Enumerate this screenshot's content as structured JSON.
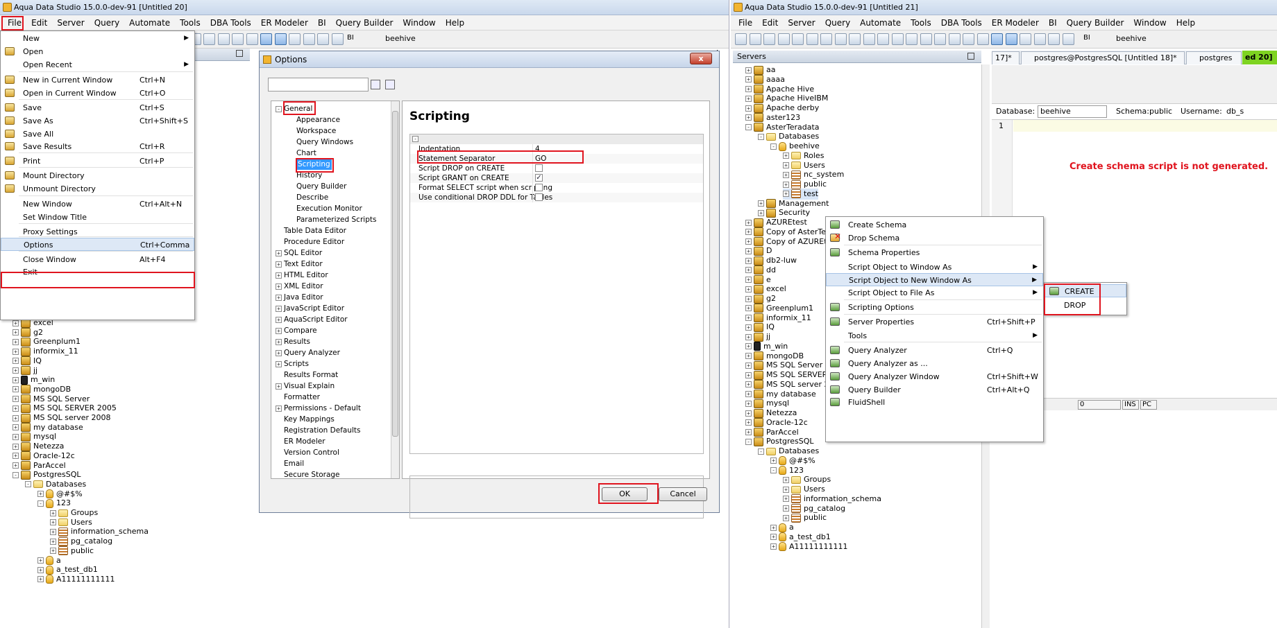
{
  "colors": {
    "highlight_box": "#e0141e",
    "note": "#e0141e",
    "selection": "#3399ff"
  },
  "win1": {
    "title": "Aqua Data Studio 15.0.0-dev-91 [Untitled 20]",
    "menubar": [
      "File",
      "Edit",
      "Server",
      "Query",
      "Automate",
      "Tools",
      "DBA Tools",
      "ER Modeler",
      "BI",
      "Query Builder",
      "Window",
      "Help"
    ],
    "toolbar_db": "beehive",
    "toolbar_bi": "BI",
    "file_menu": [
      {
        "label": "New",
        "shortcut": "",
        "submenu": true,
        "icon": ""
      },
      {
        "label": "Open",
        "shortcut": "",
        "submenu": false,
        "icon": "folder-open-icon"
      },
      {
        "label": "Open Recent",
        "shortcut": "",
        "submenu": true,
        "icon": ""
      },
      {
        "label": "New in Current Window",
        "shortcut": "Ctrl+N",
        "submenu": false,
        "icon": "new-document-icon"
      },
      {
        "label": "Open in Current Window",
        "shortcut": "Ctrl+O",
        "submenu": false,
        "icon": "folder-open-icon"
      },
      {
        "label": "Save",
        "shortcut": "Ctrl+S",
        "submenu": false,
        "icon": "save-icon"
      },
      {
        "label": "Save As",
        "shortcut": "Ctrl+Shift+S",
        "submenu": false,
        "icon": "save-as-icon"
      },
      {
        "label": "Save All",
        "shortcut": "",
        "submenu": false,
        "icon": "save-all-icon"
      },
      {
        "label": "Save Results",
        "shortcut": "Ctrl+R",
        "submenu": false,
        "icon": "save-results-icon"
      },
      {
        "label": "Print",
        "shortcut": "Ctrl+P",
        "submenu": false,
        "icon": "print-icon"
      },
      {
        "label": "Mount Directory",
        "shortcut": "",
        "submenu": false,
        "icon": "mount-icon"
      },
      {
        "label": "Unmount Directory",
        "shortcut": "",
        "submenu": false,
        "icon": "unmount-icon"
      },
      {
        "label": "New Window",
        "shortcut": "Ctrl+Alt+N",
        "submenu": false,
        "icon": ""
      },
      {
        "label": "Set Window Title",
        "shortcut": "",
        "submenu": false,
        "icon": ""
      },
      {
        "label": "Proxy Settings",
        "shortcut": "",
        "submenu": false,
        "icon": ""
      },
      {
        "label": "Options",
        "shortcut": "Ctrl+Comma",
        "submenu": false,
        "icon": ""
      },
      {
        "label": "Close Window",
        "shortcut": "Alt+F4",
        "submenu": false,
        "icon": ""
      },
      {
        "label": "Exit",
        "shortcut": "",
        "submenu": false,
        "icon": ""
      }
    ],
    "tree_bottom": [
      {
        "label": "excel",
        "indent": 0,
        "icon": "srv",
        "pm": "+"
      },
      {
        "label": "g2",
        "indent": 0,
        "icon": "srv",
        "pm": "+"
      },
      {
        "label": "Greenplum1",
        "indent": 0,
        "icon": "srv",
        "pm": "+"
      },
      {
        "label": "informix_11",
        "indent": 0,
        "icon": "srv",
        "pm": "+"
      },
      {
        "label": "IQ",
        "indent": 0,
        "icon": "srv",
        "pm": "+"
      },
      {
        "label": "jj",
        "indent": 0,
        "icon": "srv",
        "pm": "+"
      },
      {
        "label": "m_win",
        "indent": 0,
        "icon": "bin",
        "pm": "+"
      },
      {
        "label": "mongoDB",
        "indent": 0,
        "icon": "srv",
        "pm": "+"
      },
      {
        "label": "MS SQL Server",
        "indent": 0,
        "icon": "srv",
        "pm": "+"
      },
      {
        "label": "MS SQL SERVER 2005",
        "indent": 0,
        "icon": "srv",
        "pm": "+"
      },
      {
        "label": "MS SQL server 2008",
        "indent": 0,
        "icon": "srv",
        "pm": "+"
      },
      {
        "label": "my database",
        "indent": 0,
        "icon": "srv",
        "pm": "+"
      },
      {
        "label": "mysql",
        "indent": 0,
        "icon": "srv",
        "pm": "+"
      },
      {
        "label": "Netezza",
        "indent": 0,
        "icon": "srv",
        "pm": "+"
      },
      {
        "label": "Oracle-12c",
        "indent": 0,
        "icon": "srv",
        "pm": "+"
      },
      {
        "label": "ParAccel",
        "indent": 0,
        "icon": "srv",
        "pm": "+"
      },
      {
        "label": "PostgresSQL",
        "indent": 0,
        "icon": "srv",
        "pm": "-"
      },
      {
        "label": "Databases",
        "indent": 1,
        "icon": "fold",
        "pm": "-"
      },
      {
        "label": "@#$%",
        "indent": 2,
        "icon": "db",
        "pm": "+"
      },
      {
        "label": "123",
        "indent": 2,
        "icon": "db",
        "pm": "-"
      },
      {
        "label": "Groups",
        "indent": 3,
        "icon": "fold",
        "pm": "+"
      },
      {
        "label": "Users",
        "indent": 3,
        "icon": "fold",
        "pm": "+"
      },
      {
        "label": "information_schema",
        "indent": 3,
        "icon": "sch",
        "pm": "+"
      },
      {
        "label": "pg_catalog",
        "indent": 3,
        "icon": "sch",
        "pm": "+"
      },
      {
        "label": "public",
        "indent": 3,
        "icon": "sch",
        "pm": "+"
      },
      {
        "label": "a",
        "indent": 2,
        "icon": "db",
        "pm": "+"
      },
      {
        "label": "a_test_db1",
        "indent": 2,
        "icon": "db",
        "pm": "+"
      },
      {
        "label": "A11111111111",
        "indent": 2,
        "icon": "db",
        "pm": "+"
      }
    ],
    "tab_fragment": "d",
    "options_dialog": {
      "title": "Options",
      "close": "x",
      "section_title": "Scripting",
      "nav": [
        {
          "label": "General",
          "indent": 0,
          "pm": "-"
        },
        {
          "label": "Appearance",
          "indent": 1,
          "pm": ""
        },
        {
          "label": "Workspace",
          "indent": 1,
          "pm": ""
        },
        {
          "label": "Query Windows",
          "indent": 1,
          "pm": ""
        },
        {
          "label": "Chart",
          "indent": 1,
          "pm": ""
        },
        {
          "label": "Scripting",
          "indent": 1,
          "pm": ""
        },
        {
          "label": "History",
          "indent": 1,
          "pm": ""
        },
        {
          "label": "Query Builder",
          "indent": 1,
          "pm": ""
        },
        {
          "label": "Describe",
          "indent": 1,
          "pm": ""
        },
        {
          "label": "Execution Monitor",
          "indent": 1,
          "pm": ""
        },
        {
          "label": "Parameterized Scripts",
          "indent": 1,
          "pm": ""
        },
        {
          "label": "Table Data Editor",
          "indent": 0,
          "pm": ""
        },
        {
          "label": "Procedure Editor",
          "indent": 0,
          "pm": ""
        },
        {
          "label": "SQL Editor",
          "indent": 0,
          "pm": "+"
        },
        {
          "label": "Text Editor",
          "indent": 0,
          "pm": "+"
        },
        {
          "label": "HTML Editor",
          "indent": 0,
          "pm": "+"
        },
        {
          "label": "XML Editor",
          "indent": 0,
          "pm": "+"
        },
        {
          "label": "Java Editor",
          "indent": 0,
          "pm": "+"
        },
        {
          "label": "JavaScript Editor",
          "indent": 0,
          "pm": "+"
        },
        {
          "label": "AquaScript Editor",
          "indent": 0,
          "pm": "+"
        },
        {
          "label": "Compare",
          "indent": 0,
          "pm": "+"
        },
        {
          "label": "Results",
          "indent": 0,
          "pm": "+"
        },
        {
          "label": "Query Analyzer",
          "indent": 0,
          "pm": "+"
        },
        {
          "label": "Scripts",
          "indent": 0,
          "pm": "+"
        },
        {
          "label": "Results Format",
          "indent": 0,
          "pm": ""
        },
        {
          "label": "Visual Explain",
          "indent": 0,
          "pm": "+"
        },
        {
          "label": "Formatter",
          "indent": 0,
          "pm": ""
        },
        {
          "label": "Permissions - Default",
          "indent": 0,
          "pm": "+"
        },
        {
          "label": "Key Mappings",
          "indent": 0,
          "pm": ""
        },
        {
          "label": "Registration Defaults",
          "indent": 0,
          "pm": ""
        },
        {
          "label": "ER Modeler",
          "indent": 0,
          "pm": ""
        },
        {
          "label": "Version Control",
          "indent": 0,
          "pm": ""
        },
        {
          "label": "Email",
          "indent": 0,
          "pm": ""
        },
        {
          "label": "Secure Storage",
          "indent": 0,
          "pm": ""
        }
      ],
      "props": [
        {
          "label": "Indentation",
          "value": "4",
          "checkbox": false,
          "checked": false
        },
        {
          "label": "Statement Separator",
          "value": "GO",
          "checkbox": false,
          "checked": false
        },
        {
          "label": "Script DROP on CREATE",
          "value": "",
          "checkbox": true,
          "checked": false
        },
        {
          "label": "Script GRANT on CREATE",
          "value": "",
          "checkbox": true,
          "checked": true
        },
        {
          "label": "Format SELECT script when scripting",
          "value": "",
          "checkbox": true,
          "checked": false
        },
        {
          "label": "Use conditional DROP DDL for Tables",
          "value": "",
          "checkbox": true,
          "checked": false
        }
      ],
      "ok": "OK",
      "cancel": "Cancel"
    }
  },
  "win2": {
    "title": "Aqua Data Studio 15.0.0-dev-91 [Untitled 21]",
    "menubar": [
      "File",
      "Edit",
      "Server",
      "Query",
      "Automate",
      "Tools",
      "DBA Tools",
      "ER Modeler",
      "BI",
      "Query Builder",
      "Window",
      "Help"
    ],
    "toolbar_db": "beehive",
    "toolbar_bi": "BI",
    "servers_title": "Servers",
    "tree": [
      {
        "label": "aa",
        "indent": 0,
        "icon": "srv",
        "pm": "+"
      },
      {
        "label": "aaaa",
        "indent": 0,
        "icon": "srv",
        "pm": "+"
      },
      {
        "label": "Apache Hive",
        "indent": 0,
        "icon": "srv",
        "pm": "+"
      },
      {
        "label": "Apache HiveIBM",
        "indent": 0,
        "icon": "srv",
        "pm": "+"
      },
      {
        "label": "Apache derby",
        "indent": 0,
        "icon": "srv",
        "pm": "+"
      },
      {
        "label": "aster123",
        "indent": 0,
        "icon": "srv",
        "pm": "+"
      },
      {
        "label": "AsterTeradata",
        "indent": 0,
        "icon": "srv",
        "pm": "-"
      },
      {
        "label": "Databases",
        "indent": 1,
        "icon": "fold",
        "pm": "-"
      },
      {
        "label": "beehive",
        "indent": 2,
        "icon": "db",
        "pm": "-"
      },
      {
        "label": "Roles",
        "indent": 3,
        "icon": "fold",
        "pm": "+"
      },
      {
        "label": "Users",
        "indent": 3,
        "icon": "fold",
        "pm": "+"
      },
      {
        "label": "nc_system",
        "indent": 3,
        "icon": "sch",
        "pm": "+"
      },
      {
        "label": "public",
        "indent": 3,
        "icon": "sch",
        "pm": "+"
      },
      {
        "label": "test",
        "indent": 3,
        "icon": "sch",
        "pm": "+"
      },
      {
        "label": "Management",
        "indent": 1,
        "icon": "srv",
        "pm": "+"
      },
      {
        "label": "Security",
        "indent": 1,
        "icon": "srv",
        "pm": "+"
      },
      {
        "label": "AZUREtest",
        "indent": 0,
        "icon": "srv",
        "pm": "+"
      },
      {
        "label": "Copy of AsterTeradata",
        "indent": 0,
        "icon": "srv",
        "pm": "+"
      },
      {
        "label": "Copy of AZUREtest",
        "indent": 0,
        "icon": "srv",
        "pm": "+"
      },
      {
        "label": "D",
        "indent": 0,
        "icon": "srv",
        "pm": "+"
      },
      {
        "label": "db2-luw",
        "indent": 0,
        "icon": "srv",
        "pm": "+"
      },
      {
        "label": "dd",
        "indent": 0,
        "icon": "srv",
        "pm": "+"
      },
      {
        "label": "e",
        "indent": 0,
        "icon": "srv",
        "pm": "+"
      },
      {
        "label": "excel",
        "indent": 0,
        "icon": "srv",
        "pm": "+"
      },
      {
        "label": "g2",
        "indent": 0,
        "icon": "srv",
        "pm": "+"
      },
      {
        "label": "Greenplum1",
        "indent": 0,
        "icon": "srv",
        "pm": "+"
      },
      {
        "label": "informix_11",
        "indent": 0,
        "icon": "srv",
        "pm": "+"
      },
      {
        "label": "IQ",
        "indent": 0,
        "icon": "srv",
        "pm": "+"
      },
      {
        "label": "jj",
        "indent": 0,
        "icon": "srv",
        "pm": "+"
      },
      {
        "label": "m_win",
        "indent": 0,
        "icon": "bin",
        "pm": "+"
      },
      {
        "label": "mongoDB",
        "indent": 0,
        "icon": "srv",
        "pm": "+"
      },
      {
        "label": "MS SQL Server",
        "indent": 0,
        "icon": "srv",
        "pm": "+"
      },
      {
        "label": "MS SQL SERVER 2005",
        "indent": 0,
        "icon": "srv",
        "pm": "+"
      },
      {
        "label": "MS SQL server 2008",
        "indent": 0,
        "icon": "srv",
        "pm": "+"
      },
      {
        "label": "my database",
        "indent": 0,
        "icon": "srv",
        "pm": "+"
      },
      {
        "label": "mysql",
        "indent": 0,
        "icon": "srv",
        "pm": "+"
      },
      {
        "label": "Netezza",
        "indent": 0,
        "icon": "srv",
        "pm": "+"
      },
      {
        "label": "Oracle-12c",
        "indent": 0,
        "icon": "srv",
        "pm": "+"
      },
      {
        "label": "ParAccel",
        "indent": 0,
        "icon": "srv",
        "pm": "+"
      },
      {
        "label": "PostgresSQL",
        "indent": 0,
        "icon": "srv",
        "pm": "-"
      },
      {
        "label": "Databases",
        "indent": 1,
        "icon": "fold",
        "pm": "-"
      },
      {
        "label": "@#$%",
        "indent": 2,
        "icon": "db",
        "pm": "+"
      },
      {
        "label": "123",
        "indent": 2,
        "icon": "db",
        "pm": "-"
      },
      {
        "label": "Groups",
        "indent": 3,
        "icon": "fold",
        "pm": "+"
      },
      {
        "label": "Users",
        "indent": 3,
        "icon": "fold",
        "pm": "+"
      },
      {
        "label": "information_schema",
        "indent": 3,
        "icon": "sch",
        "pm": "+"
      },
      {
        "label": "pg_catalog",
        "indent": 3,
        "icon": "sch",
        "pm": "+"
      },
      {
        "label": "public",
        "indent": 3,
        "icon": "sch",
        "pm": "+"
      },
      {
        "label": "a",
        "indent": 2,
        "icon": "db",
        "pm": "+"
      },
      {
        "label": "a_test_db1",
        "indent": 2,
        "icon": "db",
        "pm": "+"
      },
      {
        "label": "A11111111111",
        "indent": 2,
        "icon": "db",
        "pm": "+"
      }
    ],
    "tabs": [
      "17]*",
      "postgres@PostgresSQL [Untitled 18]*",
      "postgres"
    ],
    "tab_overflow": "ed 20]",
    "editor": {
      "db_label": "Database:",
      "db_value": "beehive",
      "schema_label": "Schema:",
      "schema_value": "public",
      "user_label": "Username:",
      "user_value": "db_s",
      "line_no": "1"
    },
    "status": [
      "0",
      "INS",
      "PC"
    ],
    "note": "Create schema script is not generated.",
    "context_menu": [
      {
        "label": "Create Schema",
        "shortcut": "",
        "submenu": false,
        "icon": "create-schema-icon"
      },
      {
        "label": "Drop Schema",
        "shortcut": "",
        "submenu": false,
        "icon": "drop-schema-icon"
      },
      {
        "label": "Schema Properties",
        "shortcut": "",
        "submenu": false,
        "icon": "properties-icon"
      },
      {
        "label": "Script Object to Window As",
        "shortcut": "",
        "submenu": true,
        "icon": ""
      },
      {
        "label": "Script Object to New Window As",
        "shortcut": "",
        "submenu": true,
        "icon": ""
      },
      {
        "label": "Script Object to File As",
        "shortcut": "",
        "submenu": true,
        "icon": ""
      },
      {
        "label": "Scripting Options",
        "shortcut": "",
        "submenu": false,
        "icon": "scripting-options-icon"
      },
      {
        "label": "Server Properties",
        "shortcut": "Ctrl+Shift+P",
        "submenu": false,
        "icon": "server-properties-icon"
      },
      {
        "label": "Tools",
        "shortcut": "",
        "submenu": true,
        "icon": ""
      },
      {
        "label": "Query Analyzer",
        "shortcut": "Ctrl+Q",
        "submenu": false,
        "icon": "query-analyzer-icon"
      },
      {
        "label": "Query Analyzer as ...",
        "shortcut": "",
        "submenu": false,
        "icon": "query-analyzer-icon"
      },
      {
        "label": "Query Analyzer Window",
        "shortcut": "Ctrl+Shift+W",
        "submenu": false,
        "icon": "query-analyzer-icon"
      },
      {
        "label": "Query Builder",
        "shortcut": "Ctrl+Alt+Q",
        "submenu": false,
        "icon": "query-builder-icon"
      },
      {
        "label": "FluidShell",
        "shortcut": "",
        "submenu": false,
        "icon": "fluidshell-icon"
      }
    ],
    "submenu": [
      {
        "label": "CREATE",
        "icon": "create-icon"
      },
      {
        "label": "DROP",
        "icon": ""
      }
    ]
  }
}
